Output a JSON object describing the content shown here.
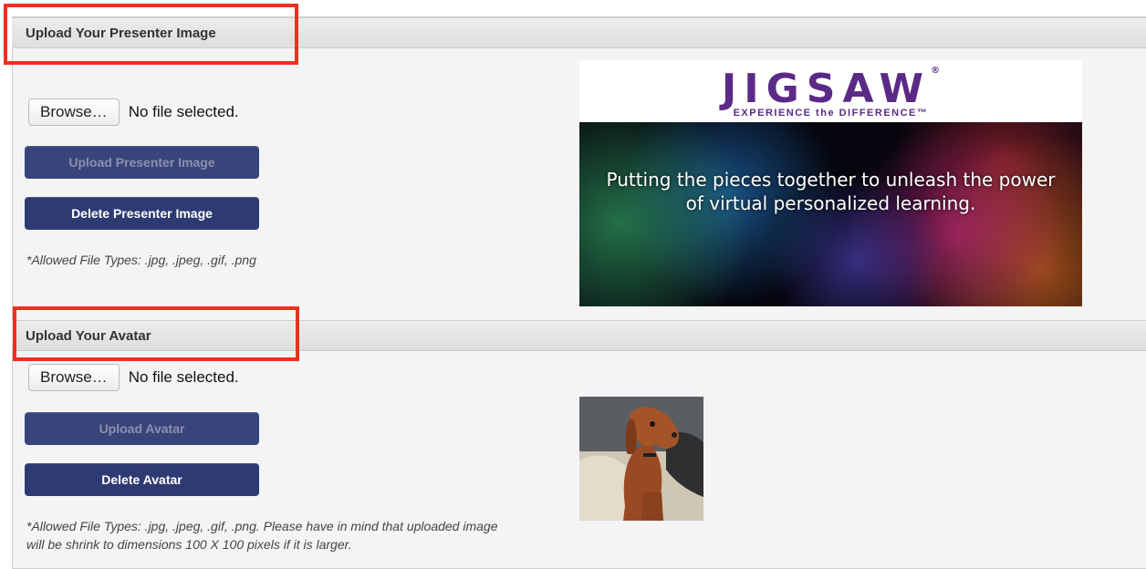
{
  "presenter": {
    "header": "Upload Your Presenter Image",
    "browse_label": "Browse…",
    "file_status": "No file selected.",
    "upload_label": "Upload Presenter Image",
    "delete_label": "Delete Presenter Image",
    "allowed_note": "*Allowed File Types: .jpg, .jpeg, .gif, .png",
    "banner": {
      "logo": "JIGSAW",
      "tagline": "EXPERIENCE the DIFFERENCE™",
      "line1": "Putting the pieces together to unleash the power",
      "line2": "of virtual personalized learning."
    }
  },
  "avatar": {
    "header": "Upload Your Avatar",
    "browse_label": "Browse…",
    "file_status": "No file selected.",
    "upload_label": "Upload Avatar",
    "delete_label": "Delete Avatar",
    "allowed_note_line1": "*Allowed File Types: .jpg, .jpeg, .gif, .png. Please have in mind that uploaded image",
    "allowed_note_line2": "will be shrink to dimensions 100 X 100 pixels if it is larger."
  },
  "colors": {
    "highlight": "#e8321f",
    "button": "#2e3b73",
    "brand_purple": "#5b2a86"
  }
}
